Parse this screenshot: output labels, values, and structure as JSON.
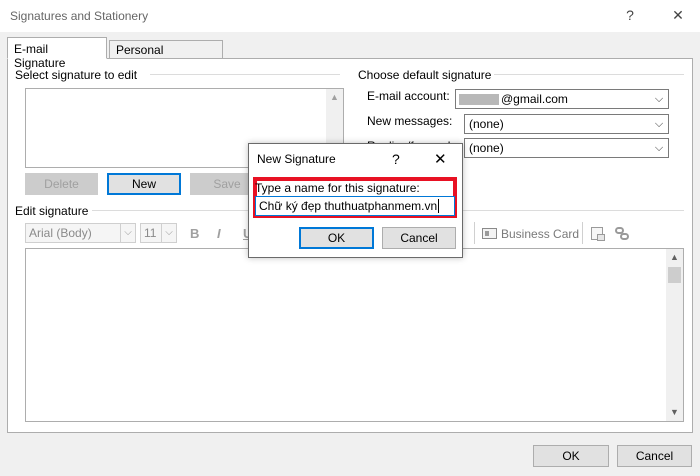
{
  "window": {
    "title": "Signatures and Stationery",
    "help_glyph": "?",
    "close_glyph": "✕"
  },
  "tabs": [
    {
      "label": "E-mail Signature",
      "active": true
    },
    {
      "label": "Personal Stationery",
      "active": false
    }
  ],
  "select_signature": {
    "label": "Select signature to edit",
    "delete_label": "Delete",
    "new_label": "New",
    "save_label": "Save"
  },
  "default_signature": {
    "label": "Choose default signature",
    "email_account_label": "E-mail account:",
    "email_account_value": "@gmail.com",
    "new_messages_label": "New messages:",
    "new_messages_value": "(none)",
    "replies_label": "Replies/forwards:",
    "replies_value": "(none)"
  },
  "edit_signature": {
    "label": "Edit signature",
    "font": "Arial (Body)",
    "size": "11",
    "bold_glyph": "B",
    "italic_glyph": "I",
    "underline_glyph": "U",
    "business_card_label": "Business Card"
  },
  "footer": {
    "ok_label": "OK",
    "cancel_label": "Cancel"
  },
  "new_signature_dialog": {
    "title": "New Signature",
    "help_glyph": "?",
    "close_glyph": "✕",
    "prompt": "Type a name for this signature:",
    "name_value": "Chữ ký đẹp thuthuatphanmem.vn",
    "ok_label": "OK",
    "cancel_label": "Cancel"
  },
  "colors": {
    "accent": "#0078d7",
    "highlight_frame": "#e81123"
  }
}
